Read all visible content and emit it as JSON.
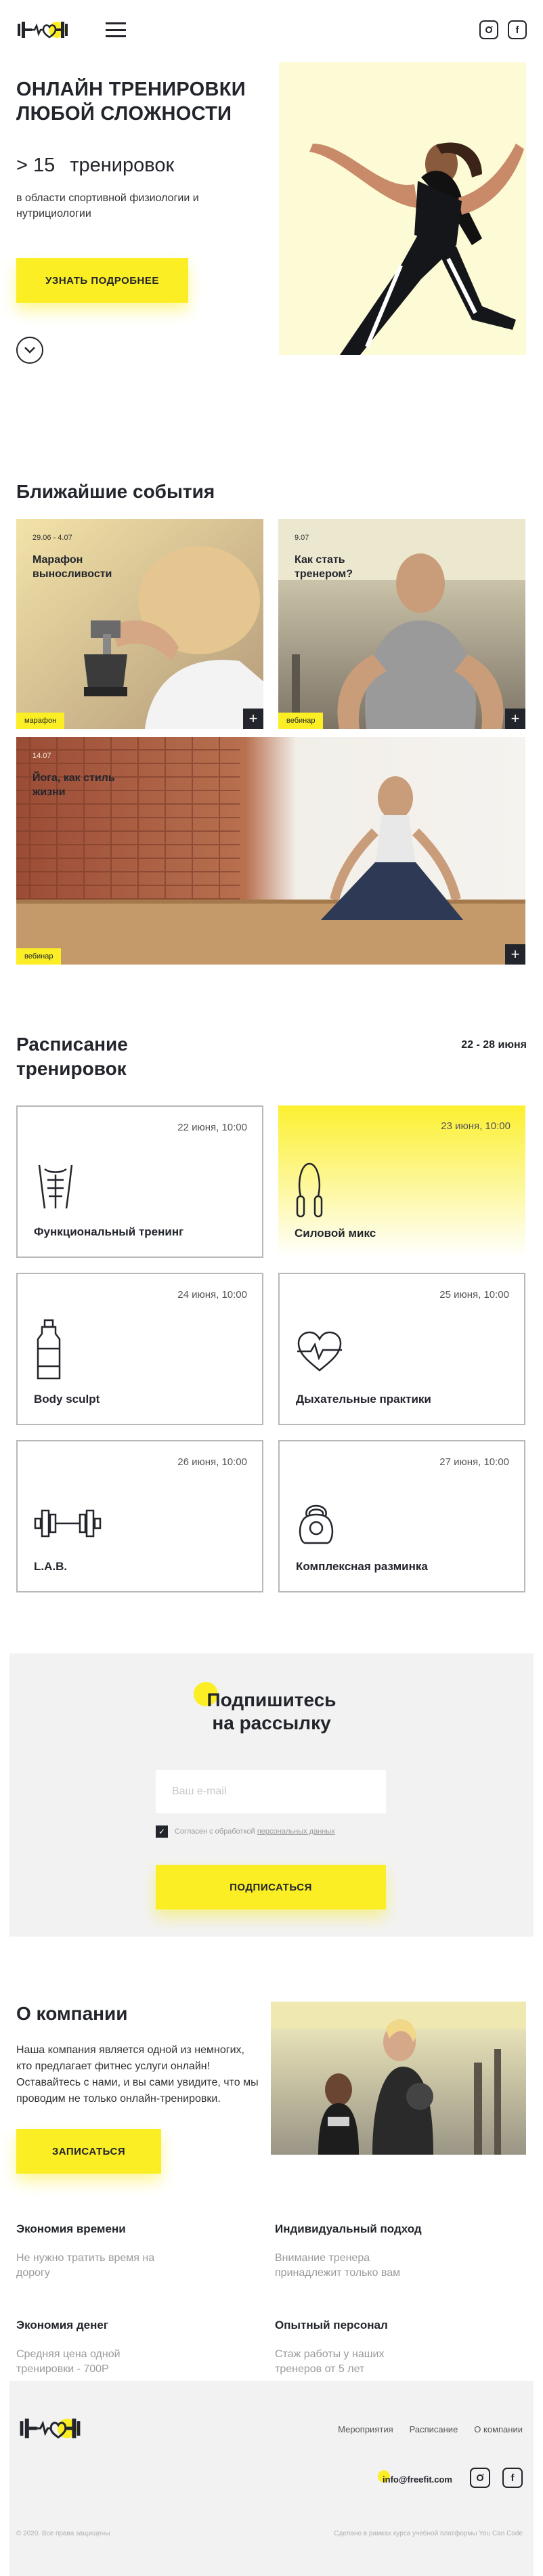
{
  "header": {
    "logo_icon": "barbell-heart-logo-icon",
    "menu_icon": "hamburger-menu-icon",
    "social": [
      {
        "icon": "instagram-icon",
        "glyph": "◎"
      },
      {
        "icon": "facebook-icon",
        "glyph": "f"
      }
    ]
  },
  "hero": {
    "title": "ОНЛАЙН ТРЕНИРОВКИ ЛЮБОЙ СЛОЖНОСТИ",
    "count_prefix": "> 15",
    "count_label": "тренировок",
    "subtitle": "в области спортивной физиологии и нутрициологии",
    "button": "УЗНАТЬ ПОДРОБНЕЕ",
    "scroll_icon": "chevron-down-circle-icon"
  },
  "events": {
    "title": "Ближайшие события",
    "items": [
      {
        "date": "29.06 - 4.07",
        "title": "Марафон выносливости",
        "tag": "марафон"
      },
      {
        "date": "9.07",
        "title": "Как стать тренером?",
        "tag": "вебинар"
      },
      {
        "date": "14.07",
        "title": "Йога, как стиль жизни",
        "tag": "вебинар"
      }
    ],
    "plus_glyph": "+"
  },
  "schedule": {
    "title": "Расписание тренировок",
    "range": "22 - 28 июня",
    "cards": [
      {
        "date": "22 июня, 10:00",
        "name": "Функциональный тренинг",
        "icon": "abs-torso-icon",
        "active": false
      },
      {
        "date": "23 июня, 10:00",
        "name": "Силовой микс",
        "icon": "jump-rope-icon",
        "active": true
      },
      {
        "date": "24 июня, 10:00",
        "name": "Body sculpt",
        "icon": "water-bottle-icon",
        "active": false
      },
      {
        "date": "25 июня, 10:00",
        "name": "Дыхательные практики",
        "icon": "heartbeat-icon",
        "active": false
      },
      {
        "date": "26 июня, 10:00",
        "name": "L.A.B.",
        "icon": "dumbbell-icon",
        "active": false
      },
      {
        "date": "27 июня, 10:00",
        "name": "Комплексная разминка",
        "icon": "kettlebell-icon",
        "active": false
      }
    ]
  },
  "subscribe": {
    "title": "Подпишитесь на рассылку",
    "placeholder": "Ваш e-mail",
    "consent_text": "Согласен с обработкой",
    "consent_link": "персональных данных",
    "button": "ПОДПИСАТЬСЯ"
  },
  "about": {
    "title": "О компании",
    "description": "Наша компания является одной из немногих, кто предлагает фитнес услуги онлайн! Оставайтесь с нами, и вы сами увидите, что мы проводим не только онлайн-тренировки.",
    "button": "ЗАПИСАТЬСЯ",
    "features": [
      {
        "title": "Экономия времени",
        "text": "Не нужно тратить время на дорогу"
      },
      {
        "title": "Индивидуальный подход",
        "text": "Внимание тренера принадлежит только вам"
      },
      {
        "title": "Экономия денег",
        "text": "Средняя цена одной тренировки - 700Р"
      },
      {
        "title": "Опытный персонал",
        "text": "Стаж работы у наших тренеров от 5 лет"
      }
    ]
  },
  "footer": {
    "nav": [
      "Мероприятия",
      "Расписание",
      "О компании"
    ],
    "email": "info@freefit.com",
    "copyright": "© 2020. Все права защищены",
    "credit": "Сделано в рамках курса учебной платформы You Can Code"
  },
  "colors": {
    "accent": "#fbee24",
    "dark": "#22252b",
    "panel": "#f2f2f2"
  }
}
